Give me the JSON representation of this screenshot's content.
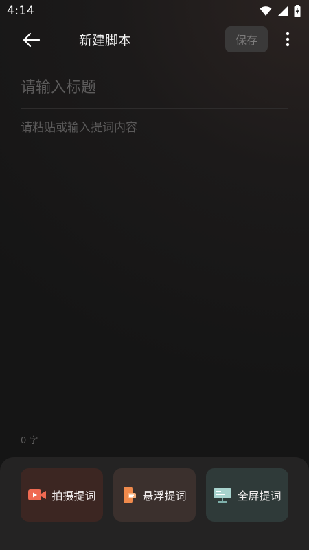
{
  "status_bar": {
    "time": "4:14"
  },
  "header": {
    "title": "新建脚本",
    "save_label": "保存"
  },
  "editor": {
    "title_placeholder": "请输入标题",
    "content_placeholder": "请粘贴或输入提词内容",
    "word_count": "0 字"
  },
  "actions": {
    "shoot_label": "拍摄提词",
    "float_label": "悬浮提词",
    "fullscreen_label": "全屏提词"
  },
  "colors": {
    "shoot_accent": "#f0684f",
    "float_accent": "#f28a4b",
    "fullscreen_accent": "#a9d4cf"
  }
}
